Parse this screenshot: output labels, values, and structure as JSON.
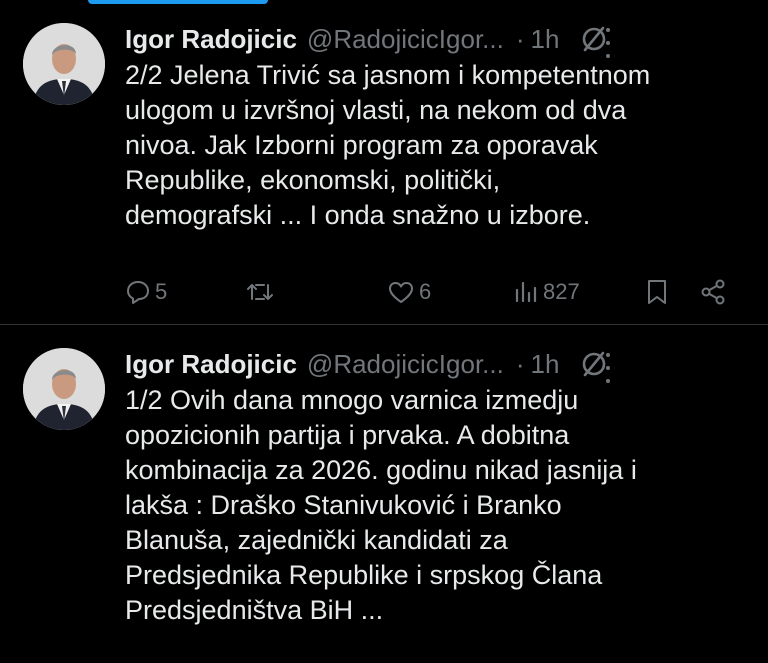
{
  "tweets": [
    {
      "author_name": "Igor Radojicic",
      "handle": "@RadojicicIgor...",
      "separator": "·",
      "time": "1h",
      "lines": [
        "2/2 Jelena Trivić sa jasnom i kompetentnom",
        "ulogom u izvršnoj vlasti, na nekom od dva",
        "nivoa. Jak Izborni program za oporavak",
        "Republike, ekonomski, politički,",
        "demografski ... I onda snažno u izbore."
      ],
      "replies": "5",
      "retweets": "",
      "likes": "6",
      "views": "827"
    },
    {
      "author_name": "Igor Radojicic",
      "handle": "@RadojicicIgor...",
      "separator": "·",
      "time": "1h",
      "lines": [
        "1/2 Ovih dana mnogo varnica izmedju",
        "opozicionih partija i prvaka. A dobitna",
        "kombinacija za 2026. godinu nikad jasnija i",
        "lakša : Draško Stanivuković i Branko",
        "Blanuša, zajednički kandidati za",
        "Predsjednika Republike i srpskog Člana",
        "Predsjedništva BiH ..."
      ]
    }
  ],
  "icons": {
    "grok": "grok-icon",
    "more": "more-icon",
    "reply": "reply-icon",
    "retweet": "retweet-icon",
    "like": "heart-icon",
    "views": "views-icon",
    "bookmark": "bookmark-icon",
    "share": "share-icon"
  },
  "colors": {
    "background": "#000000",
    "text": "#e7e9ea",
    "secondary": "#71767b",
    "divider": "#2f3336",
    "accent": "#1d9bf0"
  }
}
